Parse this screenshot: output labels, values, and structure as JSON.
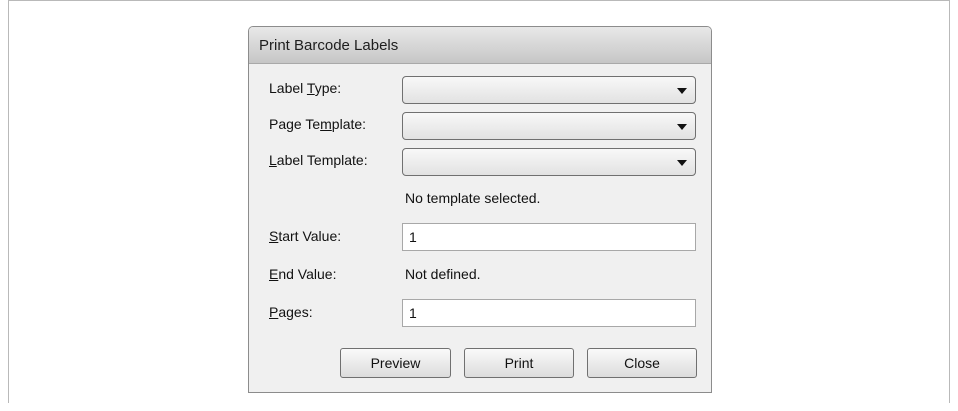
{
  "dialog": {
    "title": "Print Barcode Labels",
    "fields": {
      "label_type": {
        "pre": "Label ",
        "mnemonic": "T",
        "post": "ype:",
        "value": ""
      },
      "page_template": {
        "pre": "Page Te",
        "mnemonic": "m",
        "post": "plate:",
        "value": ""
      },
      "label_template": {
        "pre": "",
        "mnemonic": "L",
        "post": "abel Template:",
        "value": ""
      },
      "template_status": "No template selected.",
      "start_value": {
        "pre": "",
        "mnemonic": "S",
        "post": "tart Value:",
        "value": "1"
      },
      "end_value": {
        "pre": "",
        "mnemonic": "E",
        "post": "nd Value:",
        "value": "Not defined."
      },
      "pages": {
        "pre": "",
        "mnemonic": "P",
        "post": "ages:",
        "value": "1"
      }
    },
    "buttons": {
      "preview": "Preview",
      "print": "Print",
      "close": "Close"
    }
  }
}
